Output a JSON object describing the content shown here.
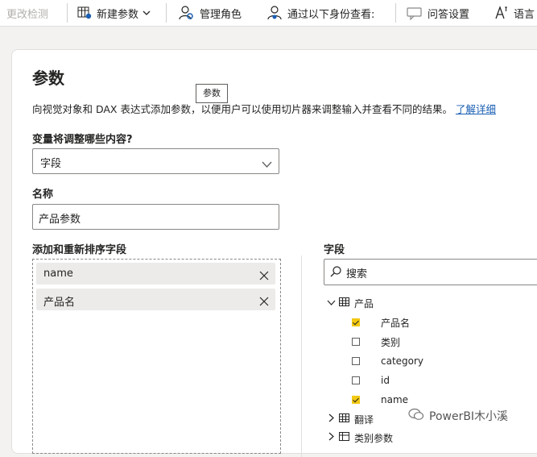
{
  "toolbar": {
    "change_detection": "更改检测",
    "new_parameter": "新建参数",
    "manage_roles": "管理角色",
    "view_as": "通过以下身份查看:",
    "qa_setup": "问答设置",
    "language": "语言"
  },
  "dialog": {
    "title": "参数",
    "tooltip": "参数",
    "description": "向视觉对象和 DAX 表达式添加参数，以便用户可以使用切片器来调整输入并查看不同的结果。",
    "learn_more": "了解详细",
    "variable_label": "变量将调整哪些内容?",
    "variable_value": "字段",
    "name_label": "名称",
    "name_value": "产品参数",
    "add_fields_label": "添加和重新排序字段",
    "selected_fields": [
      "name",
      "产品名"
    ],
    "fields_label": "字段",
    "search_placeholder": "搜索",
    "tree": {
      "table_products": "产品",
      "fields": [
        {
          "name": "产品名",
          "checked": true
        },
        {
          "name": "类别",
          "checked": false
        },
        {
          "name": "category",
          "checked": false
        },
        {
          "name": "id",
          "checked": false
        },
        {
          "name": "name",
          "checked": true
        }
      ],
      "table_translate": "翻译",
      "table_category_param": "类别参数"
    }
  },
  "watermark": "PowerBI木小溪",
  "colors": {
    "accent_check": "#f2c811",
    "link": "#1a5fb4"
  }
}
